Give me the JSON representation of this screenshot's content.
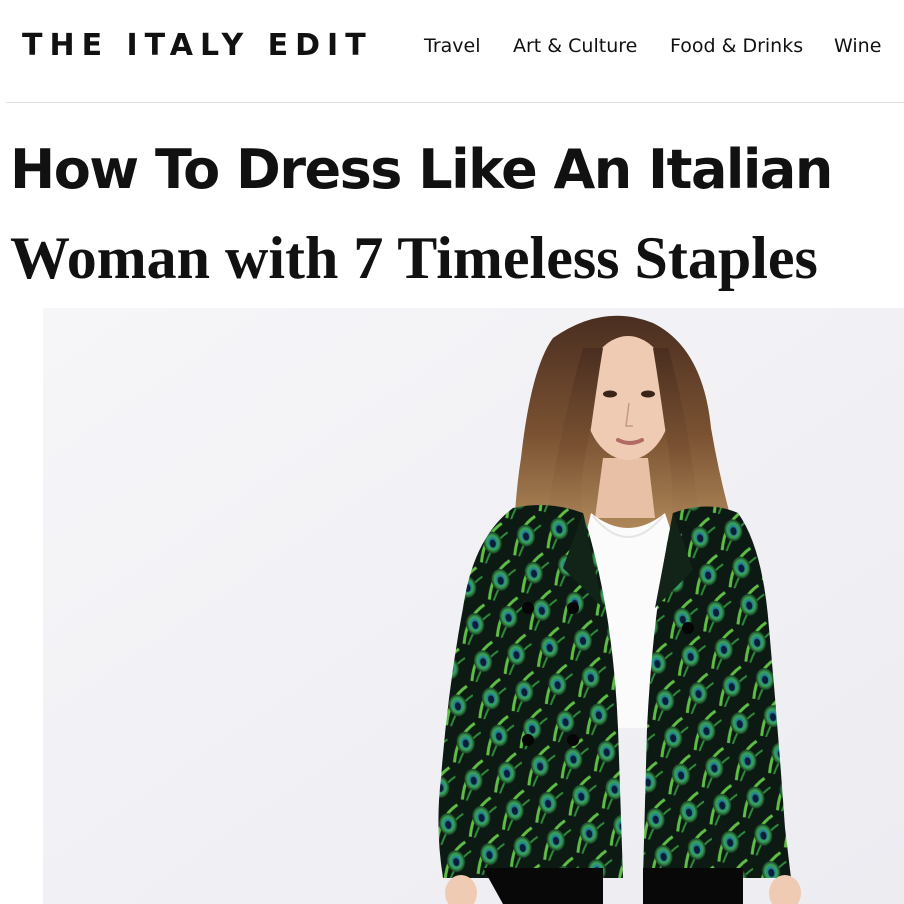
{
  "site": {
    "logo": "THE ITALY EDIT"
  },
  "nav": {
    "items": [
      "Travel",
      "Art & Culture",
      "Food & Drinks",
      "Wine"
    ]
  },
  "article": {
    "title_line1": "How To Dress Like An Italian",
    "title_line2": "Woman with 7 Timeless Staples"
  },
  "hero_image": {
    "subject": "woman-in-peacock-print-jacket"
  },
  "colors": {
    "text": "#111111",
    "divider": "#e2e2e2",
    "jacket_green": "#2f8a3a",
    "jacket_teal": "#1f6f80"
  }
}
